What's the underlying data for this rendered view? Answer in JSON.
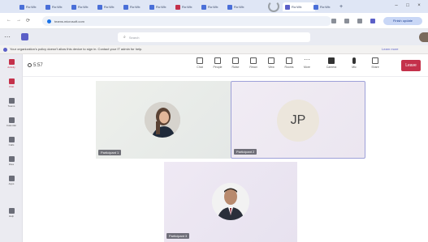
{
  "browser": {
    "tabs": [
      {
        "label": "Ro:Wh:"
      },
      {
        "label": "Ro:Wh:"
      },
      {
        "label": "Ro:Wh:"
      },
      {
        "label": "Ro:Wh:"
      },
      {
        "label": "Ro:Wh:"
      },
      {
        "label": "Ro:Wh:"
      },
      {
        "label": "Ro:Wh:"
      },
      {
        "label": "Ro:Wh:"
      },
      {
        "label": "Ro:Wh:"
      },
      {
        "label": "Ro:Wh:"
      }
    ],
    "active_tab": "Ro:Wh:",
    "new_tab_label": "+",
    "address_url": "teams.microsoft.com",
    "profile_label": "Finish update"
  },
  "teams": {
    "search_placeholder": "Search",
    "banner_text": "Your organization's policy doesn't allow this device to sign in. Contact your IT admin for help.",
    "banner_link": "Learn more",
    "rail": [
      {
        "label": "Activity",
        "icon": "bell-icon"
      },
      {
        "label": "Chat",
        "icon": "chat-icon"
      },
      {
        "label": "Teams",
        "icon": "teams-icon"
      },
      {
        "label": "Calendar",
        "icon": "calendar-icon"
      },
      {
        "label": "Calls",
        "icon": "phone-icon"
      },
      {
        "label": "Files",
        "icon": "file-icon"
      },
      {
        "label": "Apps",
        "icon": "apps-icon"
      },
      {
        "label": "Help",
        "icon": "help-icon"
      }
    ],
    "rail_active": "Activity",
    "meeting": {
      "timer": "5:57",
      "controls": [
        {
          "label": "Chat",
          "icon": "chat-icon"
        },
        {
          "label": "People",
          "icon": "people-icon"
        },
        {
          "label": "Raise",
          "icon": "hand-icon"
        },
        {
          "label": "React",
          "icon": "smile-icon"
        },
        {
          "label": "View",
          "icon": "grid-icon"
        },
        {
          "label": "Rooms",
          "icon": "rooms-icon"
        },
        {
          "label": "More",
          "icon": "more-icon"
        },
        {
          "label": "Camera",
          "icon": "camera-icon"
        },
        {
          "label": "Mic",
          "icon": "mic-icon"
        },
        {
          "label": "Share",
          "icon": "share-icon"
        }
      ],
      "leave_label": "Leave"
    },
    "participants": [
      {
        "name": "Participant 1",
        "initials": ""
      },
      {
        "name": "Participant 2",
        "initials": "JP"
      },
      {
        "name": "Participant 3",
        "initials": ""
      }
    ]
  },
  "colors": {
    "accent": "#5b5fc7",
    "leave": "#c4314b",
    "tile_bg_1": "#e8ece9",
    "tile_bg_2": "#eeeaf4",
    "tile_bg_3": "#eae6f2"
  }
}
